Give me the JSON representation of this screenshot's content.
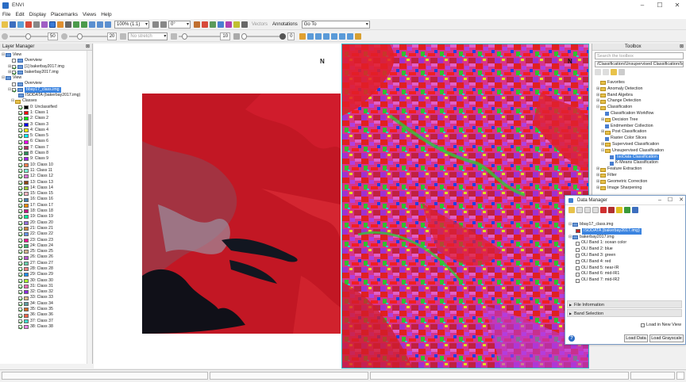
{
  "window": {
    "title": "ENVI"
  },
  "menu": [
    "File",
    "Edit",
    "Display",
    "Placemarks",
    "Views",
    "Help"
  ],
  "toolbar": {
    "zoom_value": "100% (1:1)",
    "rotation_value": "0°",
    "vectors_label": "Vectors",
    "annotations_label": "Annotations",
    "goto_value": "Go To",
    "brightness_value": "50",
    "contrast_value": "20",
    "stretch_value": "No stretch",
    "sharpen_value": "10",
    "transparency_value": "0"
  },
  "layer_manager": {
    "title": "Layer Manager",
    "items": [
      {
        "label": "View",
        "indent": 0,
        "checkbox": false,
        "expander": "⊟"
      },
      {
        "label": "Overview",
        "indent": 2,
        "checkbox": true,
        "checked": false
      },
      {
        "label": "[1] bakerbay2017.img",
        "indent": 2,
        "checkbox": true,
        "checked": true,
        "expander": "⊞"
      },
      {
        "label": "bakerbay2017.img",
        "indent": 2,
        "checkbox": true,
        "checked": true,
        "expander": "⊞"
      },
      {
        "label": "View",
        "indent": 0,
        "checkbox": false,
        "expander": "⊟"
      },
      {
        "label": "Overview",
        "indent": 2,
        "checkbox": true,
        "checked": false
      },
      {
        "label": "bbay17_class.img",
        "indent": 2,
        "checkbox": true,
        "checked": true,
        "expander": "⊟",
        "selected": true
      },
      {
        "label": "ISODATA (bakerbay2017.img)",
        "indent": 4,
        "checkbox": false
      },
      {
        "label": "Classes",
        "indent": 3,
        "checkbox": false,
        "expander": "⊟"
      }
    ],
    "classes": [
      {
        "label": "0: Unclassified",
        "color": "#000000"
      },
      {
        "label": "1: Class 1",
        "color": "#ff0000"
      },
      {
        "label": "2: Class 2",
        "color": "#00ff00"
      },
      {
        "label": "3: Class 3",
        "color": "#0000ff"
      },
      {
        "label": "4: Class 4",
        "color": "#ffff00"
      },
      {
        "label": "5: Class 5",
        "color": "#00ffff"
      },
      {
        "label": "6: Class 6",
        "color": "#ff00ff"
      },
      {
        "label": "7: Class 7",
        "color": "#b03060"
      },
      {
        "label": "8: Class 8",
        "color": "#2e8b57"
      },
      {
        "label": "9: Class 9",
        "color": "#a020f0"
      },
      {
        "label": "10: Class 10",
        "color": "#ff7f50"
      },
      {
        "label": "11: Class 11",
        "color": "#7fffd4"
      },
      {
        "label": "12: Class 12",
        "color": "#da70d6"
      },
      {
        "label": "13: Class 13",
        "color": "#8b4513"
      },
      {
        "label": "14: Class 14",
        "color": "#9acd32"
      },
      {
        "label": "15: Class 15",
        "color": "#ffb6c1"
      },
      {
        "label": "16: Class 16",
        "color": "#4682b4"
      },
      {
        "label": "17: Class 17",
        "color": "#ff8c00"
      },
      {
        "label": "18: Class 18",
        "color": "#c71585"
      },
      {
        "label": "19: Class 19",
        "color": "#00fa9a"
      },
      {
        "label": "20: Class 20",
        "color": "#9370db"
      },
      {
        "label": "21: Class 21",
        "color": "#cd853f"
      },
      {
        "label": "22: Class 22",
        "color": "#6495ed"
      },
      {
        "label": "23: Class 23",
        "color": "#ff1493"
      },
      {
        "label": "24: Class 24",
        "color": "#3cb371"
      },
      {
        "label": "25: Class 25",
        "color": "#d2b48c"
      },
      {
        "label": "26: Class 26",
        "color": "#ba55d3"
      },
      {
        "label": "27: Class 27",
        "color": "#66cdaa"
      },
      {
        "label": "28: Class 28",
        "color": "#f08080"
      },
      {
        "label": "29: Class 29",
        "color": "#1e90ff"
      },
      {
        "label": "30: Class 30",
        "color": "#adff2f"
      },
      {
        "label": "31: Class 31",
        "color": "#ff69b4"
      },
      {
        "label": "32: Class 32",
        "color": "#8a2be2"
      },
      {
        "label": "33: Class 33",
        "color": "#deb887"
      },
      {
        "label": "34: Class 34",
        "color": "#5f9ea0"
      },
      {
        "label": "35: Class 35",
        "color": "#d2691e"
      },
      {
        "label": "36: Class 36",
        "color": "#ff6347"
      },
      {
        "label": "37: Class 37",
        "color": "#40e0d0"
      },
      {
        "label": "38: Class 38",
        "color": "#ee82ee"
      }
    ]
  },
  "views": {
    "north_label": "N"
  },
  "toolbox": {
    "title": "Toolbox",
    "search_placeholder": "Search the toolbox",
    "path": "/Classification/Unsupervised Classification/IsoDa",
    "items": [
      {
        "label": "Favorites",
        "indent": 1,
        "kind": "folder",
        "expander": ""
      },
      {
        "label": "Anomaly Detection",
        "indent": 1,
        "kind": "folder",
        "expander": "⊞"
      },
      {
        "label": "Band Algebra",
        "indent": 1,
        "kind": "folder",
        "expander": "⊞"
      },
      {
        "label": "Change Detection",
        "indent": 1,
        "kind": "folder",
        "expander": "⊞"
      },
      {
        "label": "Classification",
        "indent": 1,
        "kind": "folder",
        "expander": "⊟"
      },
      {
        "label": "Classification Workflow",
        "indent": 3,
        "kind": "tool"
      },
      {
        "label": "Decision Tree",
        "indent": 3,
        "kind": "folder",
        "expander": "⊞"
      },
      {
        "label": "Endmember Collection",
        "indent": 3,
        "kind": "tool"
      },
      {
        "label": "Post Classification",
        "indent": 3,
        "kind": "folder",
        "expander": "⊞"
      },
      {
        "label": "Raster Color Slices",
        "indent": 3,
        "kind": "tool"
      },
      {
        "label": "Supervised Classification",
        "indent": 3,
        "kind": "folder",
        "expander": "⊞"
      },
      {
        "label": "Unsupervised Classification",
        "indent": 3,
        "kind": "folder",
        "expander": "⊟"
      },
      {
        "label": "IsoData Classification",
        "indent": 5,
        "kind": "tool",
        "selected": true
      },
      {
        "label": "K-Means Classification",
        "indent": 5,
        "kind": "tool"
      },
      {
        "label": "Feature Extraction",
        "indent": 1,
        "kind": "folder",
        "expander": "⊞"
      },
      {
        "label": "Filter",
        "indent": 1,
        "kind": "folder",
        "expander": "⊞"
      },
      {
        "label": "Geometric Correction",
        "indent": 1,
        "kind": "folder",
        "expander": "⊞"
      },
      {
        "label": "Image Sharpening",
        "indent": 1,
        "kind": "folder",
        "expander": "⊞"
      }
    ]
  },
  "data_manager": {
    "title": "Data Manager",
    "items": [
      {
        "label": "bbay17_class.img",
        "indent": 0,
        "expander": "⊟"
      },
      {
        "label": "ISODATA (bakerbay2017.img)",
        "indent": 3,
        "selected": true,
        "swatch": "#d02020"
      },
      {
        "label": "bakerbay2017.img",
        "indent": 0,
        "expander": "⊟"
      },
      {
        "label": "OLI Band 1: ocean color",
        "indent": 3,
        "checkbox": true
      },
      {
        "label": "OLI Band 2: blue",
        "indent": 3,
        "checkbox": true
      },
      {
        "label": "OLI Band 3: green",
        "indent": 3,
        "checkbox": true
      },
      {
        "label": "OLI Band 4: red",
        "indent": 3,
        "checkbox": true
      },
      {
        "label": "OLI Band 5: near-IR",
        "indent": 3,
        "checkbox": true
      },
      {
        "label": "OLI Band 6: mid-IR1",
        "indent": 3,
        "checkbox": true
      },
      {
        "label": "OLI Band 7: mid-IR2",
        "indent": 3,
        "checkbox": true
      }
    ],
    "file_information": "File Information",
    "band_selection": "Band Selection",
    "load_new_view": "Load in New View",
    "load_data": "Load Data",
    "load_grayscale": "Load Grayscale"
  }
}
